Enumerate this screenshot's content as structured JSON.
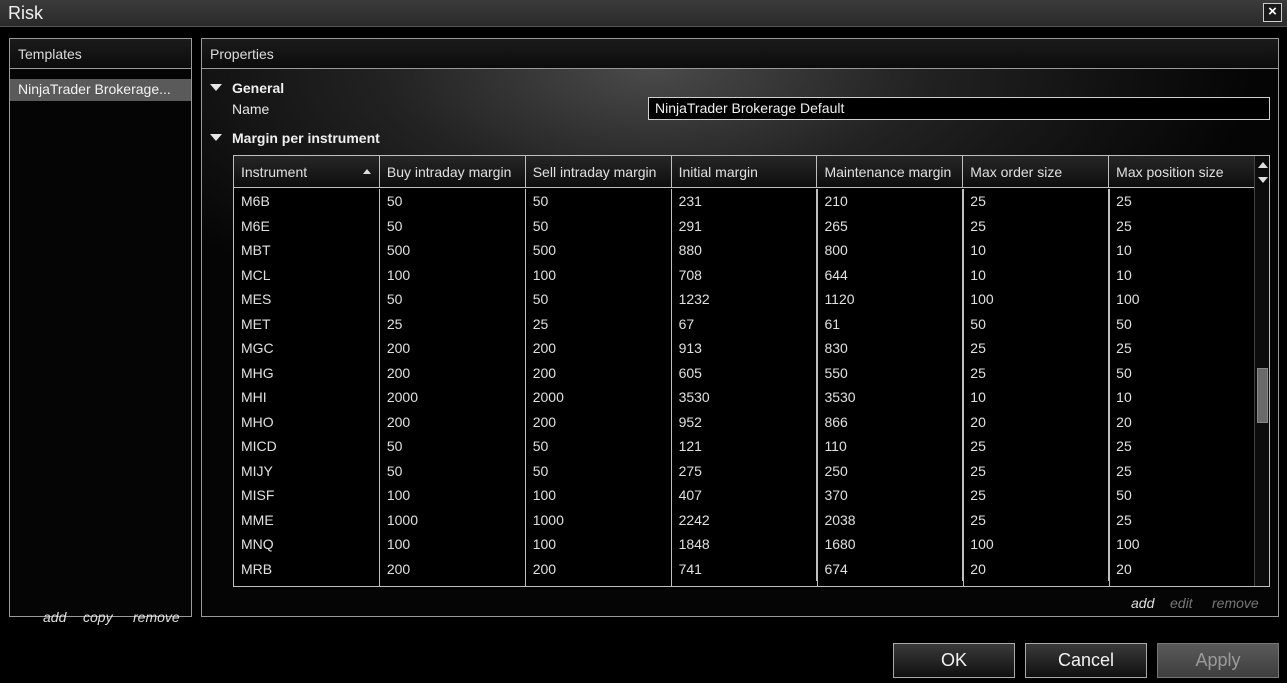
{
  "window": {
    "title": "Risk",
    "close_icon": "close-icon"
  },
  "templates": {
    "header": "Templates",
    "items": [
      "NinjaTrader Brokerage..."
    ],
    "actions": {
      "add": "add",
      "copy": "copy",
      "remove": "remove"
    }
  },
  "properties": {
    "header": "Properties",
    "general": {
      "label": "General",
      "name_label": "Name",
      "name_value": "NinjaTrader Brokerage Default"
    },
    "margin": {
      "label": "Margin per instrument",
      "columns": [
        "Instrument",
        "Buy intraday margin",
        "Sell intraday margin",
        "Initial margin",
        "Maintenance margin",
        "Max order size",
        "Max position size"
      ],
      "rows": [
        [
          "M6B",
          "50",
          "50",
          "231",
          "210",
          "25",
          "25"
        ],
        [
          "M6E",
          "50",
          "50",
          "291",
          "265",
          "25",
          "25"
        ],
        [
          "MBT",
          "500",
          "500",
          "880",
          "800",
          "10",
          "10"
        ],
        [
          "MCL",
          "100",
          "100",
          "708",
          "644",
          "10",
          "10"
        ],
        [
          "MES",
          "50",
          "50",
          "1232",
          "1120",
          "100",
          "100"
        ],
        [
          "MET",
          "25",
          "25",
          "67",
          "61",
          "50",
          "50"
        ],
        [
          "MGC",
          "200",
          "200",
          "913",
          "830",
          "25",
          "25"
        ],
        [
          "MHG",
          "200",
          "200",
          "605",
          "550",
          "25",
          "50"
        ],
        [
          "MHI",
          "2000",
          "2000",
          "3530",
          "3530",
          "10",
          "10"
        ],
        [
          "MHO",
          "200",
          "200",
          "952",
          "866",
          "20",
          "20"
        ],
        [
          "MICD",
          "50",
          "50",
          "121",
          "110",
          "25",
          "25"
        ],
        [
          "MIJY",
          "50",
          "50",
          "275",
          "250",
          "25",
          "25"
        ],
        [
          "MISF",
          "100",
          "100",
          "407",
          "370",
          "25",
          "50"
        ],
        [
          "MME",
          "1000",
          "1000",
          "2242",
          "2038",
          "25",
          "25"
        ],
        [
          "MNQ",
          "100",
          "100",
          "1848",
          "1680",
          "100",
          "100"
        ],
        [
          "MRB",
          "200",
          "200",
          "741",
          "674",
          "20",
          "20"
        ]
      ],
      "actions": {
        "add": "add",
        "edit": "edit",
        "remove": "remove"
      }
    }
  },
  "buttons": {
    "ok": "OK",
    "cancel": "Cancel",
    "apply": "Apply"
  }
}
